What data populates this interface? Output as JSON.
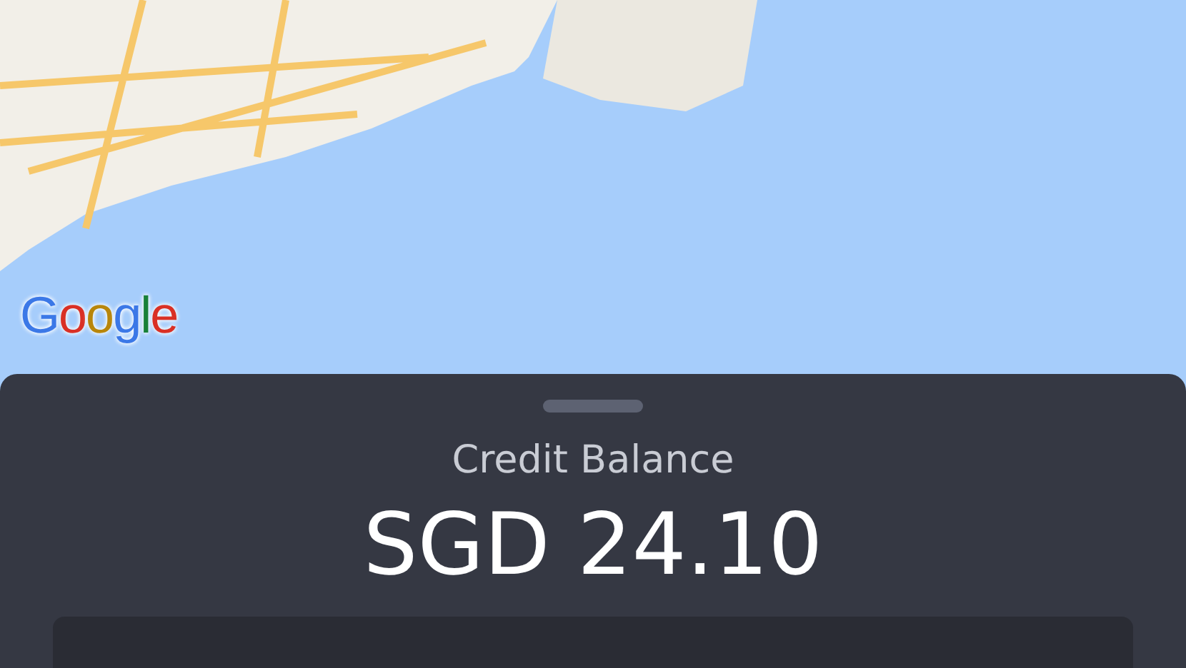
{
  "map": {
    "attribution": "Google"
  },
  "sheet": {
    "title": "Credit Balance",
    "amount": "SGD 24.10"
  }
}
